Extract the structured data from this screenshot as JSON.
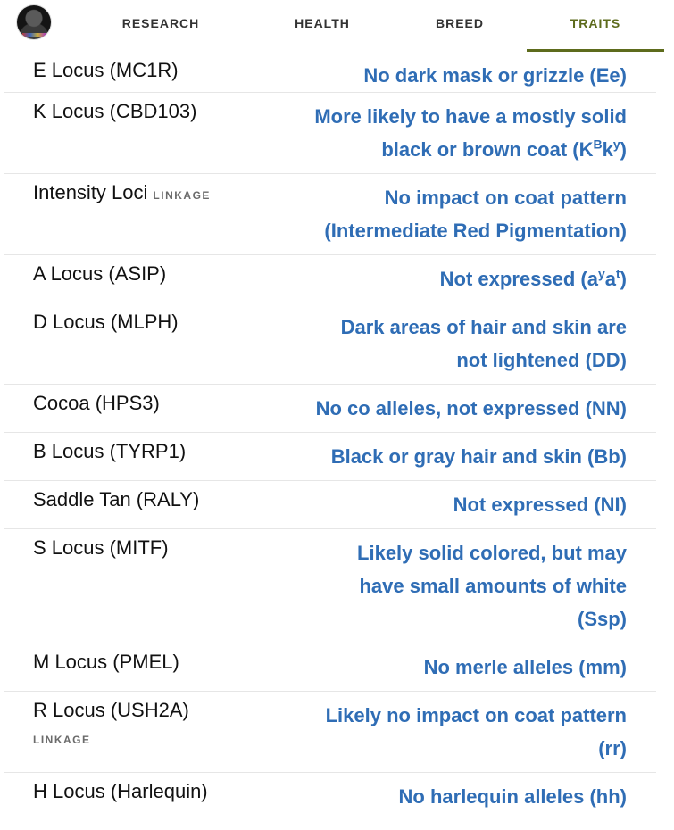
{
  "nav": {
    "tabs": [
      {
        "label": "RESEARCH"
      },
      {
        "label": "HEALTH"
      },
      {
        "label": "BREED"
      },
      {
        "label": "TRAITS"
      }
    ],
    "active_tab": "TRAITS",
    "accent_color": "#5d6b1c"
  },
  "traits": [
    {
      "name": "E Locus (MC1R)",
      "tag": "",
      "value": "No dark mask or grizzle (Ee)"
    },
    {
      "name": "K Locus (CBD103)",
      "tag": "",
      "value_main": "More likely to have a mostly solid black or brown coat (K",
      "sup1": "B",
      "mid": "k",
      "sup2": "y",
      "end": ")"
    },
    {
      "name": "Intensity Loci",
      "tag": "LINKAGE",
      "value": "No impact on coat pattern (Intermediate Red Pigmentation)"
    },
    {
      "name": "A Locus (ASIP)",
      "tag": "",
      "value_main": "Not expressed (a",
      "sup1": "y",
      "mid": "a",
      "sup2": "t",
      "end": ")"
    },
    {
      "name": "D Locus (MLPH)",
      "tag": "",
      "value": "Dark areas of hair and skin are not lightened (DD)"
    },
    {
      "name": "Cocoa (HPS3)",
      "tag": "",
      "value": "No co alleles, not expressed (NN)"
    },
    {
      "name": "B Locus (TYRP1)",
      "tag": "",
      "value": "Black or gray hair and skin (Bb)"
    },
    {
      "name": "Saddle Tan (RALY)",
      "tag": "",
      "value": "Not expressed (NI)"
    },
    {
      "name": "S Locus (MITF)",
      "tag": "",
      "value": "Likely solid colored, but may have small amounts of white (Ssp)"
    },
    {
      "name": "M Locus (PMEL)",
      "tag": "",
      "value": "No merle alleles (mm)"
    },
    {
      "name": "R Locus (USH2A)",
      "tag": "LINKAGE",
      "value": "Likely no impact on coat pattern (rr)"
    },
    {
      "name": "H Locus (Harlequin)",
      "tag": "",
      "value": "No harlequin alleles (hh)"
    }
  ],
  "value_color": "#2f6db5"
}
